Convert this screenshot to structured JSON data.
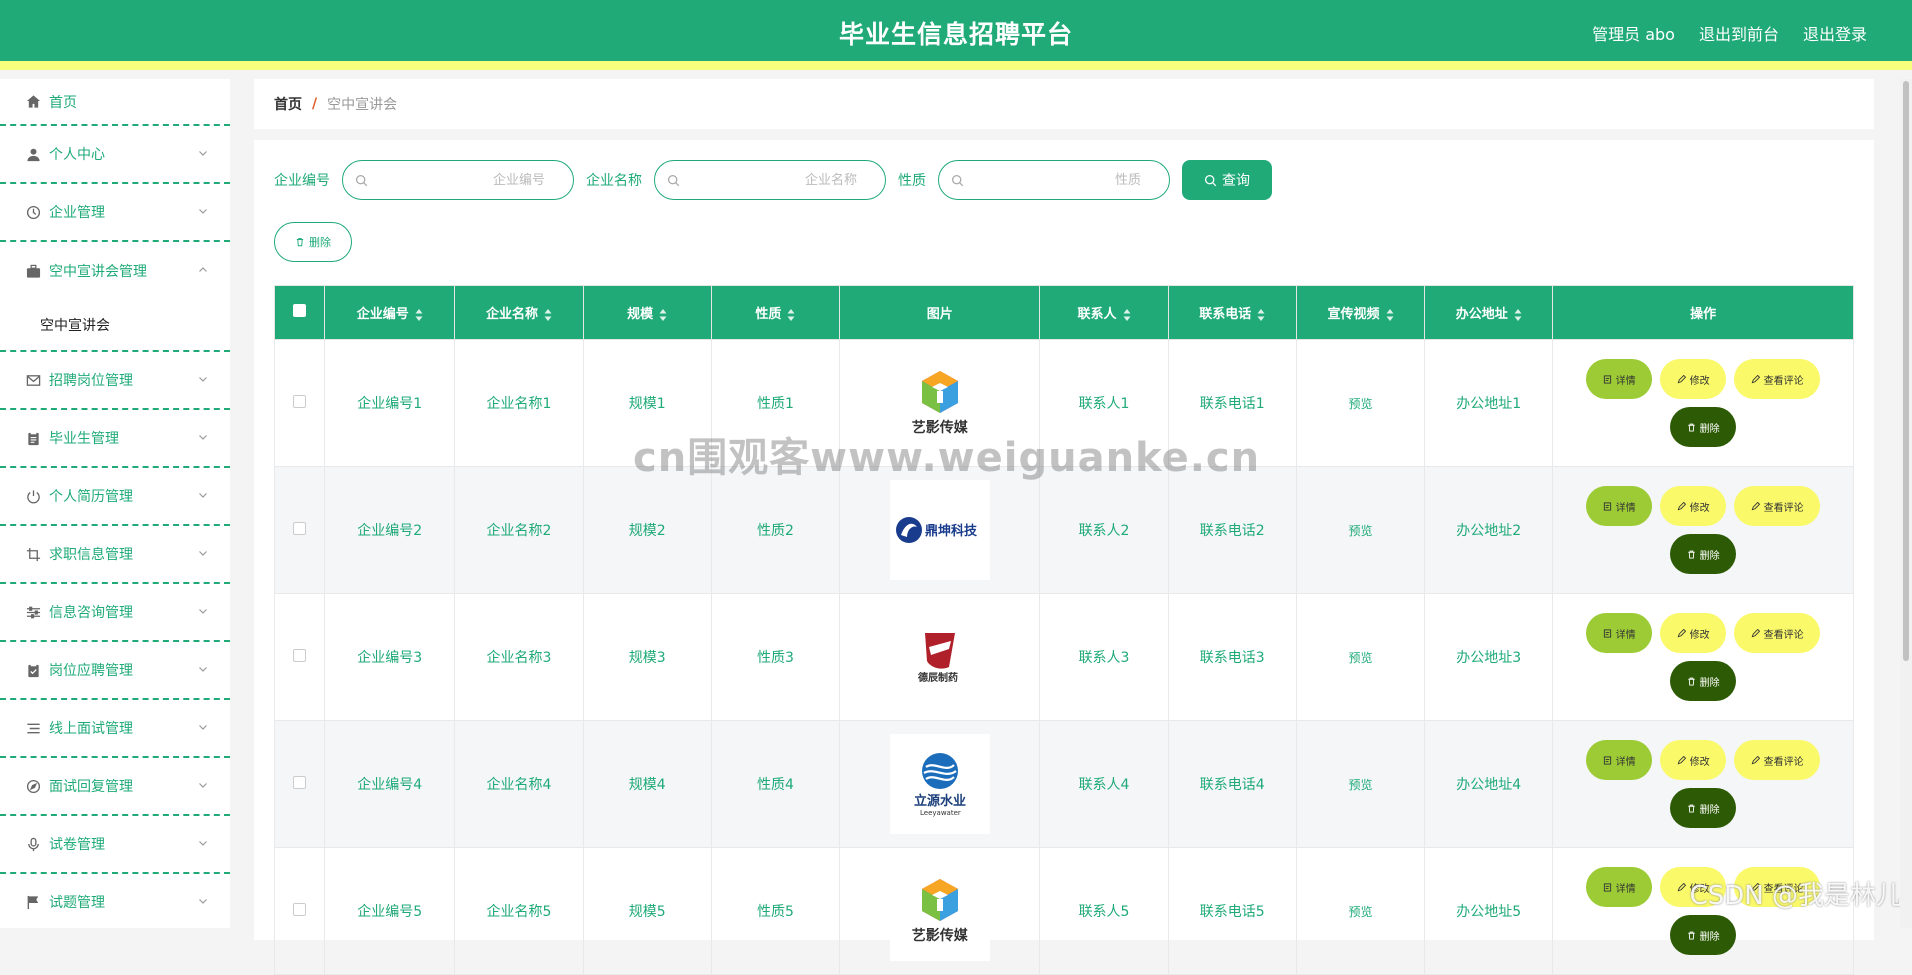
{
  "header": {
    "title": "毕业生信息招聘平台",
    "user": "管理员 abo",
    "to_front": "退出到前台",
    "logout": "退出登录"
  },
  "sidebar": {
    "items": [
      {
        "label": "首页",
        "icon": "home-icon"
      },
      {
        "label": "个人中心",
        "icon": "user-icon"
      },
      {
        "label": "企业管理",
        "icon": "clock-icon"
      },
      {
        "label": "空中宣讲会管理",
        "icon": "briefcase-icon",
        "open": true,
        "sub": [
          "空中宣讲会"
        ]
      },
      {
        "label": "招聘岗位管理",
        "icon": "mail-icon"
      },
      {
        "label": "毕业生管理",
        "icon": "clipboard-icon"
      },
      {
        "label": "个人简历管理",
        "icon": "power-icon"
      },
      {
        "label": "求职信息管理",
        "icon": "crop-icon"
      },
      {
        "label": "信息咨询管理",
        "icon": "sliders-icon"
      },
      {
        "label": "岗位应聘管理",
        "icon": "clipboard-check-icon"
      },
      {
        "label": "线上面试管理",
        "icon": "list-icon"
      },
      {
        "label": "面试回复管理",
        "icon": "compass-icon"
      },
      {
        "label": "试卷管理",
        "icon": "mic-icon"
      },
      {
        "label": "试题管理",
        "icon": "flag-icon"
      }
    ]
  },
  "breadcrumb": {
    "home": "首页",
    "sep": "/",
    "current": "空中宣讲会"
  },
  "search": {
    "fields": [
      {
        "label": "企业编号",
        "placeholder": "企业编号"
      },
      {
        "label": "企业名称",
        "placeholder": "企业名称"
      },
      {
        "label": "性质",
        "placeholder": "性质"
      }
    ],
    "query_label": "查询",
    "delete_label": "删除"
  },
  "table": {
    "columns": [
      "企业编号",
      "企业名称",
      "规模",
      "性质",
      "图片",
      "联系人",
      "联系电话",
      "宣传视频",
      "办公地址",
      "操作"
    ],
    "rows": [
      {
        "id": "企业编号1",
        "name": "企业名称1",
        "scale": "规模1",
        "nature": "性质1",
        "logo": "艺影传媒",
        "contact": "联系人1",
        "phone": "联系电话1",
        "video": "预览",
        "address": "办公地址1"
      },
      {
        "id": "企业编号2",
        "name": "企业名称2",
        "scale": "规模2",
        "nature": "性质2",
        "logo": "鼎坤科技",
        "contact": "联系人2",
        "phone": "联系电话2",
        "video": "预览",
        "address": "办公地址2"
      },
      {
        "id": "企业编号3",
        "name": "企业名称3",
        "scale": "规模3",
        "nature": "性质3",
        "logo": "德辰制药",
        "contact": "联系人3",
        "phone": "联系电话3",
        "video": "预览",
        "address": "办公地址3"
      },
      {
        "id": "企业编号4",
        "name": "企业名称4",
        "scale": "规模4",
        "nature": "性质4",
        "logo": "立源水业",
        "contact": "联系人4",
        "phone": "联系电话4",
        "video": "预览",
        "address": "办公地址4"
      },
      {
        "id": "企业编号5",
        "name": "企业名称5",
        "scale": "规模5",
        "nature": "性质5",
        "logo": "艺影传媒",
        "contact": "联系人5",
        "phone": "联系电话5",
        "video": "预览",
        "address": "办公地址5"
      }
    ],
    "actions": {
      "detail": "详情",
      "edit": "修改",
      "review": "查看评论",
      "delete": "删除"
    }
  },
  "watermark": "cn围观客www.weiguanke.cn",
  "csdn": "CSDN @我是林儿",
  "colors": {
    "primary": "#1faa78",
    "accent_yellow": "#f7ff7d",
    "dark_green": "#2d5a05",
    "lime": "#9ccb36"
  }
}
